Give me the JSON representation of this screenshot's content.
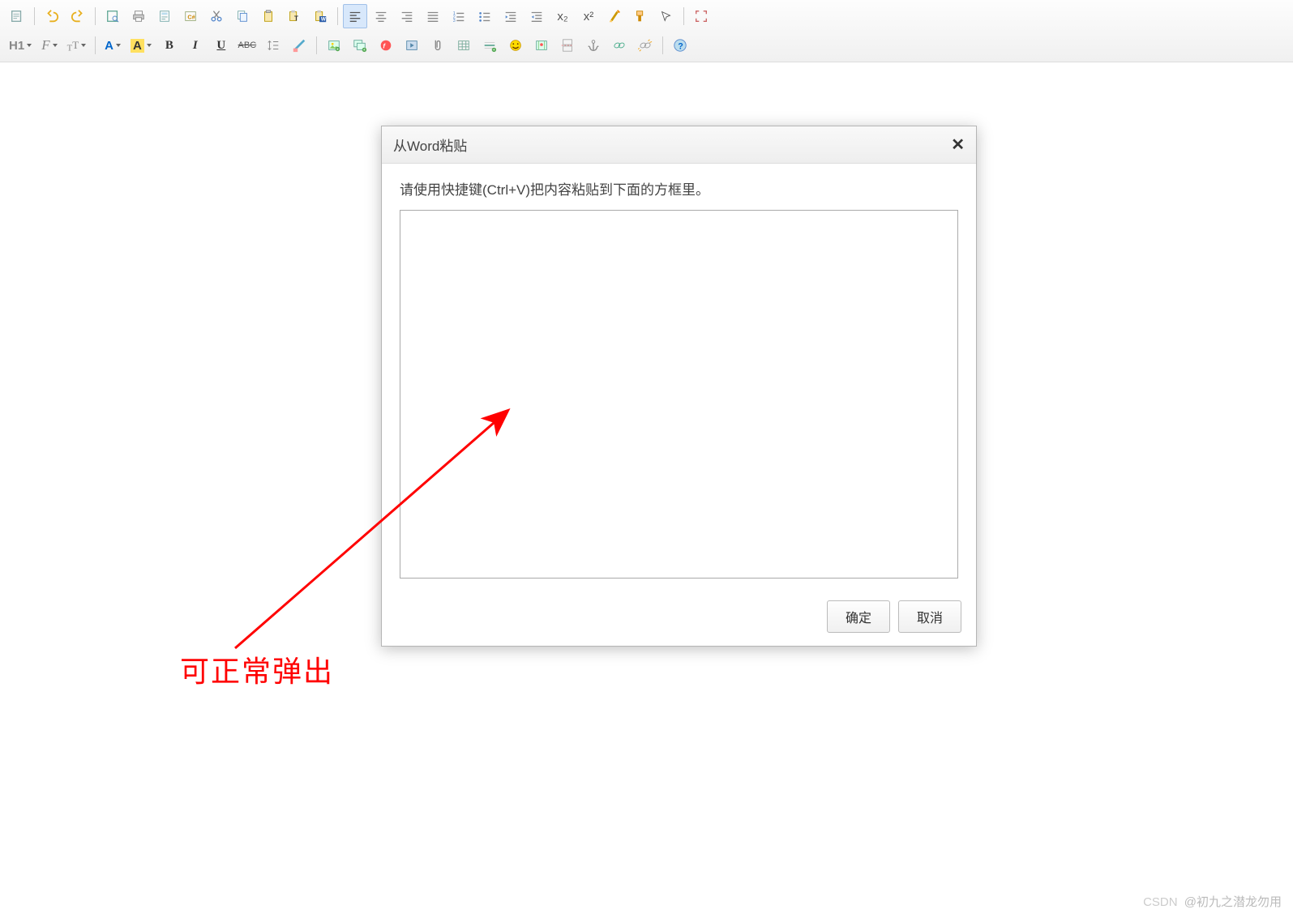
{
  "toolbar": {
    "row1": {
      "heading_label": "H1",
      "font_label": "F",
      "size_label": "T",
      "forecolor_label": "A",
      "backcolor_label": "A",
      "bold_label": "B",
      "italic_label": "I",
      "underline_label": "U",
      "strike_label": "ABC"
    }
  },
  "dialog": {
    "title": "从Word粘贴",
    "message": "请使用快捷键(Ctrl+V)把内容粘贴到下面的方框里。",
    "ok_label": "确定",
    "cancel_label": "取消",
    "paste_value": ""
  },
  "annotation": {
    "text": "可正常弹出"
  },
  "watermark": {
    "source": "CSDN",
    "author": "@初九之潜龙勿用"
  },
  "icons": {
    "subscript": "x₂",
    "superscript": "x²"
  }
}
